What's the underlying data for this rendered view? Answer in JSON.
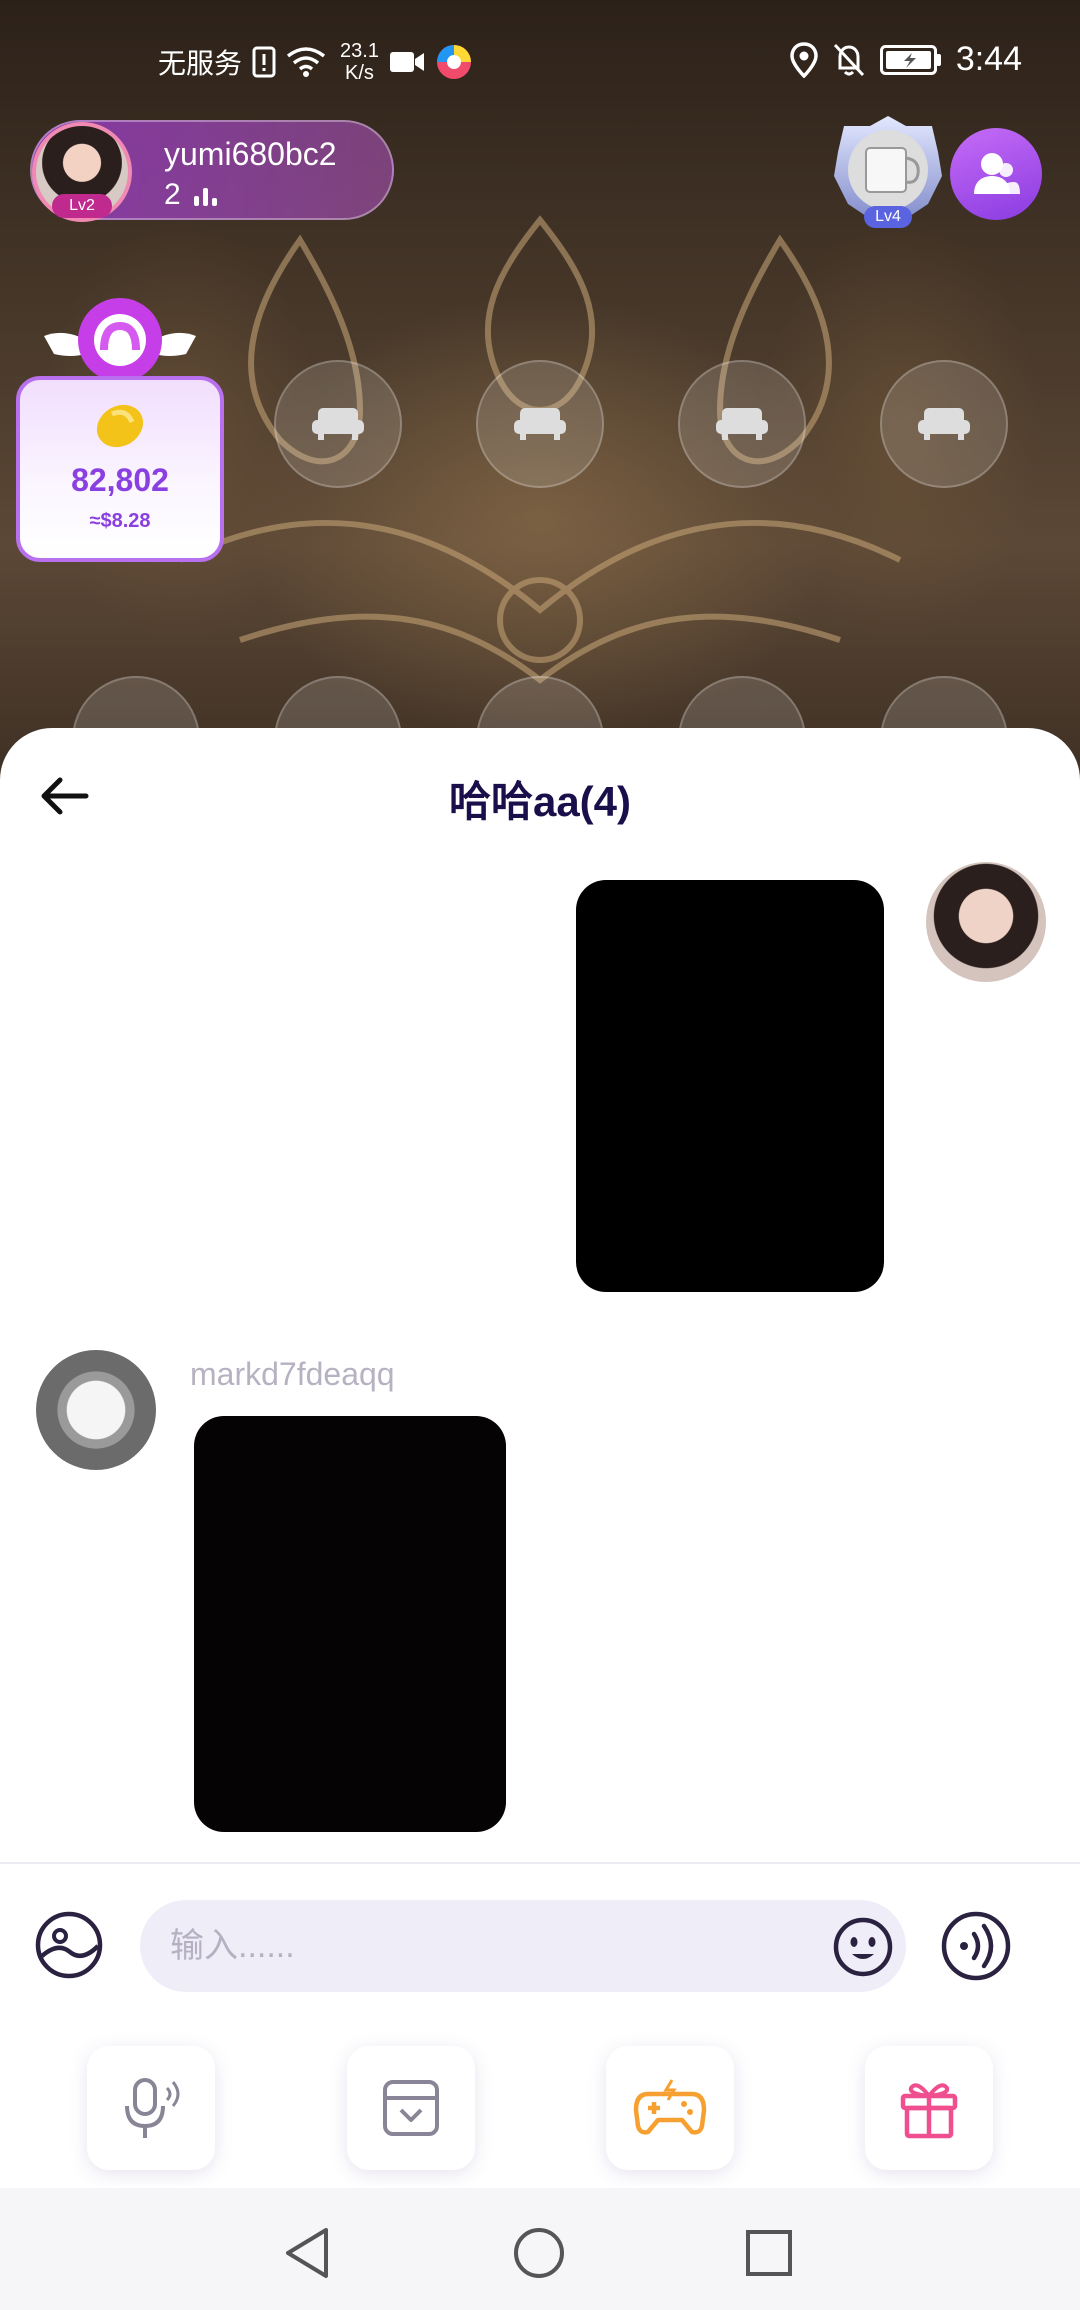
{
  "status_bar": {
    "carrier": "无服务",
    "net_speed_value": "23.1",
    "net_speed_unit": "K/s",
    "time": "3:44"
  },
  "room": {
    "host_name": "yumi680bc2",
    "host_level": "Lv2",
    "online_count": "2",
    "owner_level": "Lv4"
  },
  "coins": {
    "amount": "82,802",
    "usd": "≈$8.28"
  },
  "chat": {
    "title": "哈哈aa(4)",
    "other_sender": "markd7fdeaqq"
  },
  "composer": {
    "placeholder": "输入......"
  },
  "icons": {
    "gallery": "gallery-icon",
    "emoji": "emoji-icon",
    "voice": "voice-icon",
    "mic": "mic-icon",
    "sticker": "sticker-icon",
    "game": "gamepad-icon",
    "gift": "gift-icon"
  },
  "colors": {
    "accent": "#8a3fe0",
    "title": "#1a0f4a",
    "game": "#f5a031",
    "gift": "#ef4f8f"
  }
}
